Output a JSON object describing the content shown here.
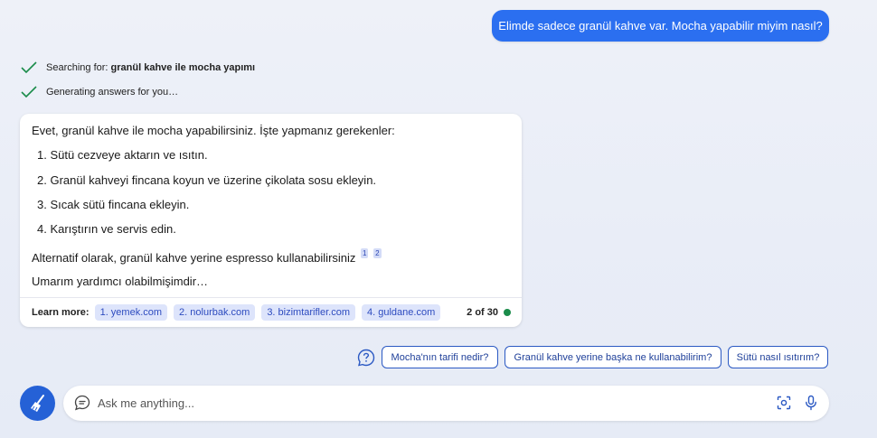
{
  "user_message": "Elimde sadece granül kahve var. Mocha yapabilir miyim nasıl?",
  "status": {
    "searching_prefix": "Searching for: ",
    "searching_query": "granül kahve ile mocha yapımı",
    "generating": "Generating answers for you…"
  },
  "answer": {
    "intro": "Evet, granül kahve ile mocha yapabilirsiniz. İşte yapmanız gerekenler:",
    "steps": [
      "1. Sütü cezveye aktarın ve ısıtın.",
      "2. Granül kahveyi fincana koyun ve üzerine çikolata sosu ekleyin.",
      "3. Sıcak sütü fincana ekleyin.",
      "4. Karıştırın ve servis edin."
    ],
    "alternative": "Alternatif olarak, granül kahve yerine espresso kullanabilirsiniz",
    "citations": [
      "1",
      "2"
    ],
    "closing": "Umarım yardımcı olabilmişimdir…"
  },
  "learn_more": {
    "label": "Learn more:",
    "sources": [
      "1. yemek.com",
      "2. nolurbak.com",
      "3. bizimtarifler.com",
      "4. guldane.com"
    ],
    "counter": "2 of 30",
    "status_color": "#1a8c4a"
  },
  "suggestions": [
    "Mocha'nın tarifi nedir?",
    "Granül kahve yerine başka ne kullanabilirim?",
    "Sütü nasıl ısıtırım?"
  ],
  "input": {
    "placeholder": "Ask me anything..."
  },
  "colors": {
    "accent": "#2b6ff0",
    "check": "#1a8c4a"
  },
  "icons": [
    "check-icon",
    "help-icon",
    "broom-icon",
    "chat-icon",
    "visual-search-icon",
    "microphone-icon"
  ]
}
